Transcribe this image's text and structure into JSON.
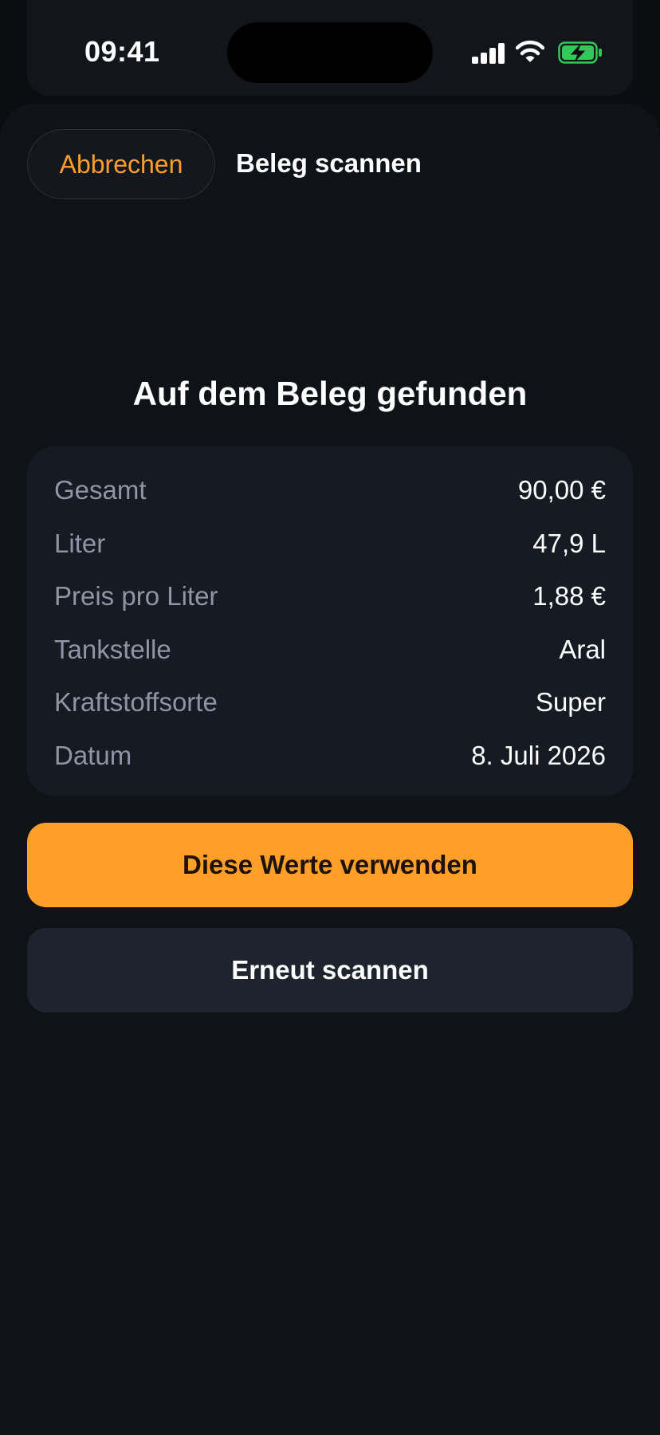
{
  "status_bar": {
    "time": "09:41",
    "icons": [
      "signal-icon",
      "wifi-icon",
      "battery-charging-icon"
    ]
  },
  "sheet": {
    "cancel_label": "Abbrechen",
    "title": "Beleg scannen"
  },
  "results": {
    "heading": "Auf dem Beleg gefunden",
    "rows": [
      {
        "label": "Gesamt",
        "value": "90,00 €"
      },
      {
        "label": "Liter",
        "value": "47,9 L"
      },
      {
        "label": "Preis pro Liter",
        "value": "1,88 €"
      },
      {
        "label": "Tankstelle",
        "value": "Aral"
      },
      {
        "label": "Kraftstoffsorte",
        "value": "Super"
      },
      {
        "label": "Datum",
        "value": "8. Juli 2026"
      }
    ]
  },
  "actions": {
    "use_values_label": "Diese Werte verwenden",
    "rescan_label": "Erneut scannen"
  },
  "colors": {
    "accent": "#ff9f2a",
    "background": "#0b0d11",
    "card": "#161b23",
    "battery": "#34c759"
  }
}
